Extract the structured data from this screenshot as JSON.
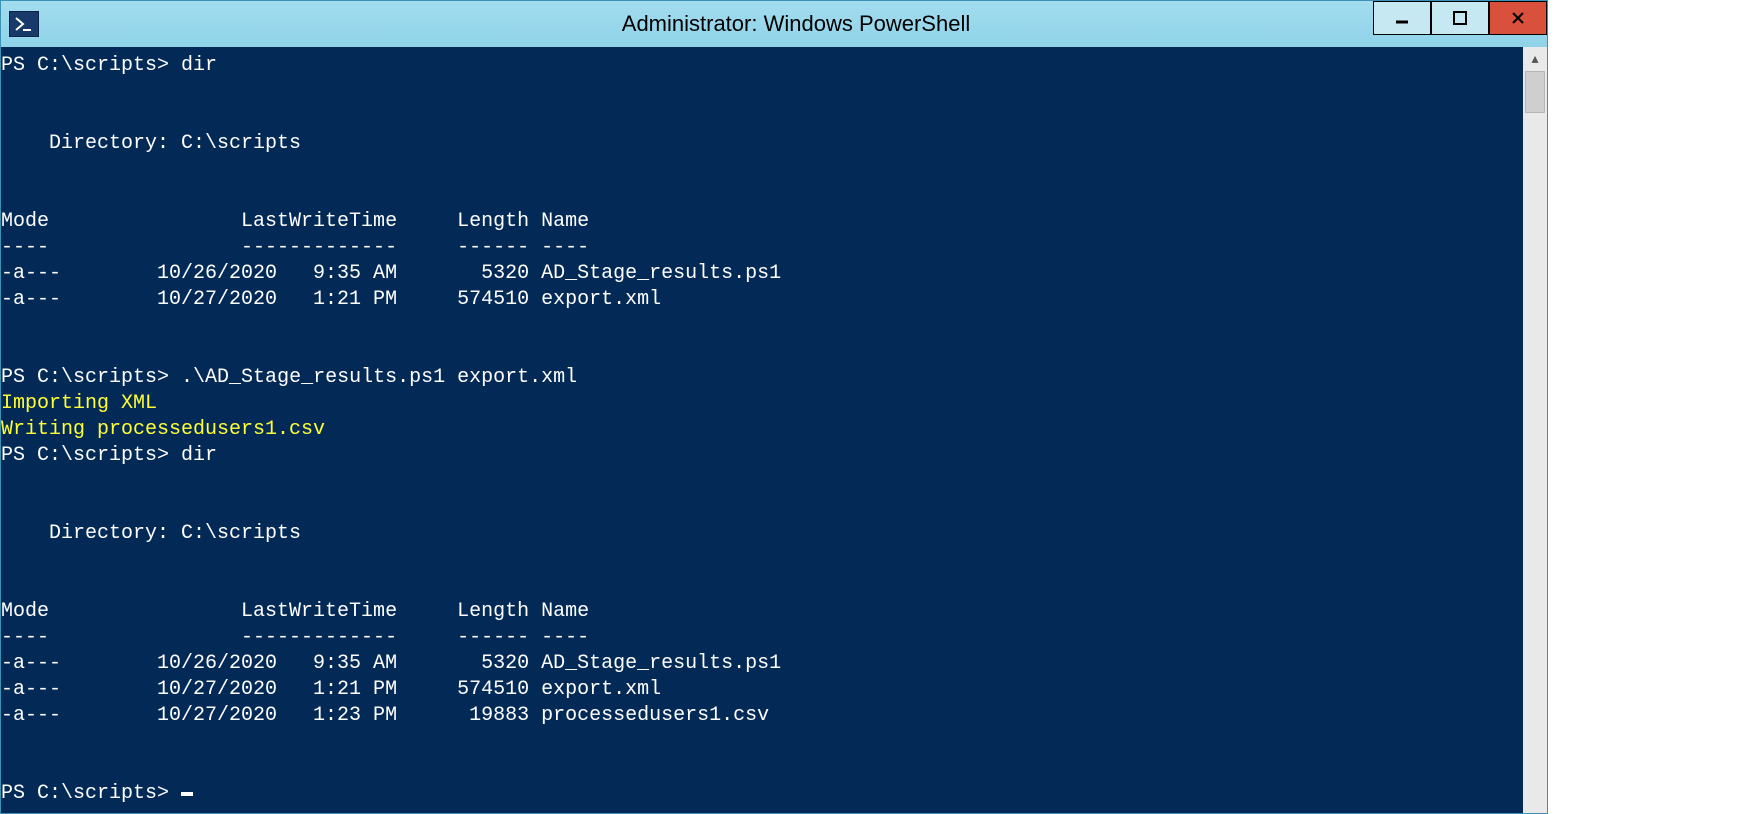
{
  "window": {
    "title": "Administrator: Windows PowerShell",
    "icon": "powershell-icon"
  },
  "term": {
    "prompt": "PS C:\\scripts>",
    "cmd_dir": "dir",
    "cmd_run": ".\\AD_Stage_results.ps1 export.xml",
    "dir_header": "    Directory: C:\\scripts",
    "tbl_headers": {
      "mode": "Mode",
      "lwt": "LastWriteTime",
      "len": "Length",
      "name": "Name"
    },
    "listing1": [
      {
        "mode": "-a---",
        "date": "10/26/2020",
        "time": "9:35 AM",
        "len": "5320",
        "name": "AD_Stage_results.ps1"
      },
      {
        "mode": "-a---",
        "date": "10/27/2020",
        "time": "1:21 PM",
        "len": "574510",
        "name": "export.xml"
      }
    ],
    "script_out": [
      "Importing XML",
      "Writing processedusers1.csv"
    ],
    "listing2": [
      {
        "mode": "-a---",
        "date": "10/26/2020",
        "time": "9:35 AM",
        "len": "5320",
        "name": "AD_Stage_results.ps1"
      },
      {
        "mode": "-a---",
        "date": "10/27/2020",
        "time": "1:21 PM",
        "len": "574510",
        "name": "export.xml"
      },
      {
        "mode": "-a---",
        "date": "10/27/2020",
        "time": "1:23 PM",
        "len": "19883",
        "name": "processedusers1.csv"
      }
    ]
  }
}
